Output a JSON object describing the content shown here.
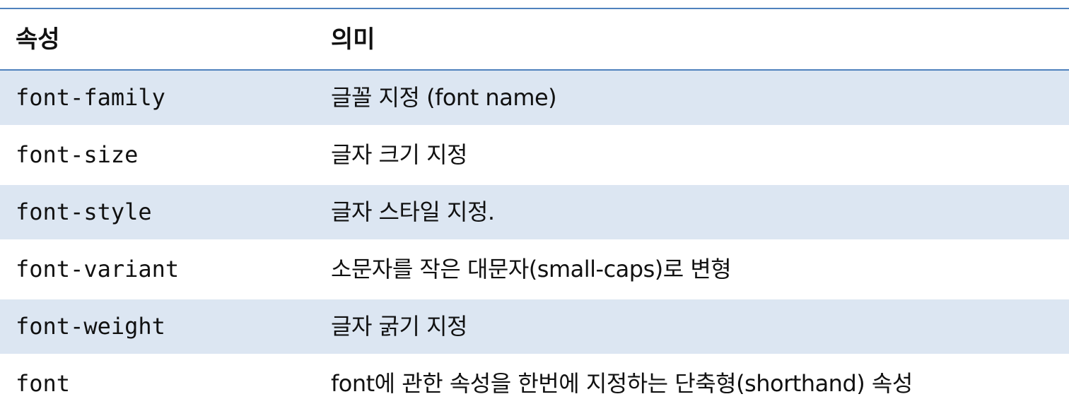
{
  "table": {
    "headers": {
      "property": "속성",
      "meaning": "의미"
    },
    "rows": [
      {
        "property": "font-family",
        "meaning": "글꼴 지정 (font name)"
      },
      {
        "property": "font-size",
        "meaning": "글자 크기 지정"
      },
      {
        "property": "font-style",
        "meaning": "글자 스타일 지정."
      },
      {
        "property": "font-variant",
        "meaning": "소문자를 작은 대문자(small-caps)로 변형"
      },
      {
        "property": "font-weight",
        "meaning": "글자 굵기 지정"
      },
      {
        "property": "font",
        "meaning": "font에 관한 속성을 한번에 지정하는 단축형(shorthand) 속성"
      }
    ]
  },
  "colors": {
    "rule": "#4f81bd",
    "shaded_row": "#dce6f2",
    "text": "#111111"
  }
}
